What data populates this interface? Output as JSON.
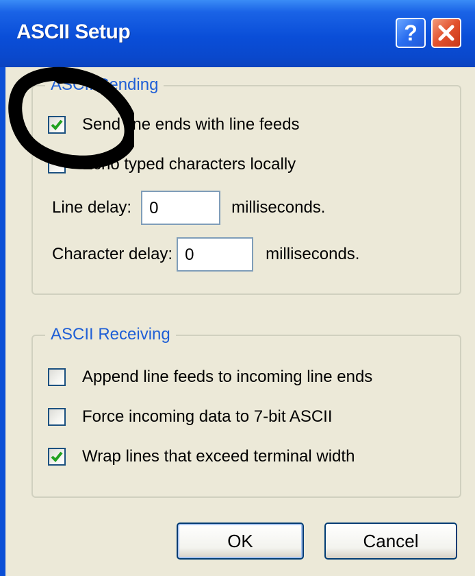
{
  "window": {
    "title": "ASCII Setup",
    "help_glyph": "?",
    "close_glyph": "✕"
  },
  "sending": {
    "legend": "ASCII Sending",
    "send_line_ends": {
      "label": "Send line ends with line feeds",
      "checked": true
    },
    "echo_typed": {
      "label": "Echo typed characters locally",
      "checked": false
    },
    "line_delay": {
      "label": "Line delay:",
      "value": "0",
      "unit": "milliseconds."
    },
    "char_delay": {
      "label": "Character delay:",
      "value": "0",
      "unit": "milliseconds."
    }
  },
  "receiving": {
    "legend": "ASCII Receiving",
    "append_line_feeds": {
      "label": "Append line feeds to incoming line ends",
      "checked": false
    },
    "force_7bit": {
      "label": "Force incoming data to 7-bit ASCII",
      "checked": false
    },
    "wrap_lines": {
      "label": "Wrap lines that exceed terminal width",
      "checked": true
    }
  },
  "buttons": {
    "ok": "OK",
    "cancel": "Cancel"
  },
  "colors": {
    "titlebar": "#0a4ed8",
    "dialog_bg": "#ece9d8",
    "group_label": "#1f5fd6",
    "checkmark": "#21a121",
    "close_button": "#e2512d",
    "marker": "#000000"
  },
  "icons": {
    "help": "help-icon",
    "close": "close-icon",
    "check": "checkmark-icon"
  }
}
